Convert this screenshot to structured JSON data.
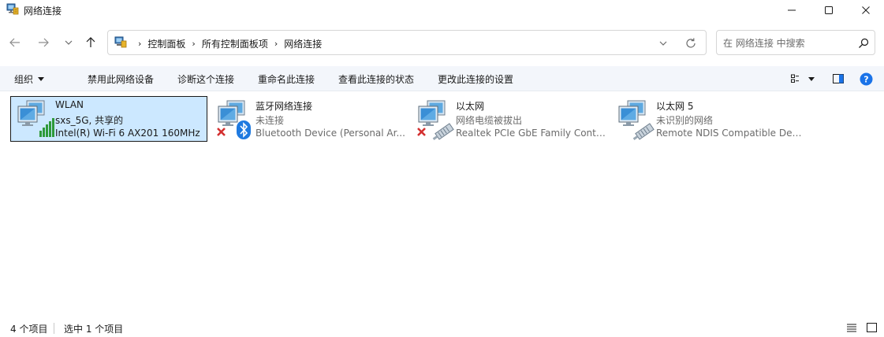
{
  "window": {
    "title": "网络连接"
  },
  "address": {
    "crumbs": [
      "控制面板",
      "所有控制面板项",
      "网络连接"
    ],
    "separator": "›"
  },
  "search": {
    "placeholder": "在 网络连接 中搜索"
  },
  "commands": {
    "organize": "组织",
    "items": [
      "禁用此网络设备",
      "诊断这个连接",
      "重命名此连接",
      "查看此连接的状态",
      "更改此连接的设置"
    ]
  },
  "connections": [
    {
      "name": "WLAN",
      "status": "sxs_5G, 共享的",
      "device": "Intel(R) Wi-Fi 6 AX201 160MHz",
      "icon": "wifi-signal-icon",
      "selected": true
    },
    {
      "name": "蓝牙网络连接",
      "status": "未连接",
      "device": "Bluetooth Device (Personal Ar...",
      "icon": "bluetooth-icon",
      "selected": false
    },
    {
      "name": "以太网",
      "status": "网络电缆被拔出",
      "device": "Realtek PCIe GbE Family Contr...",
      "icon": "ethernet-cable-icon",
      "selected": false
    },
    {
      "name": "以太网 5",
      "status": "未识别的网络",
      "device": "Remote NDIS Compatible Dev...",
      "icon": "ethernet-cable-icon",
      "selected": false
    }
  ],
  "statusbar": {
    "count": "4 个项目",
    "selected": "选中 1 个项目"
  },
  "colors": {
    "selection_bg": "#cce8ff",
    "cmdbar_bg": "#f3f6fb",
    "help_blue": "#1a73e8",
    "error_red": "#d32f2f",
    "bluetooth_blue": "#1f7ae0",
    "signal_green": "#2e9a3a"
  }
}
